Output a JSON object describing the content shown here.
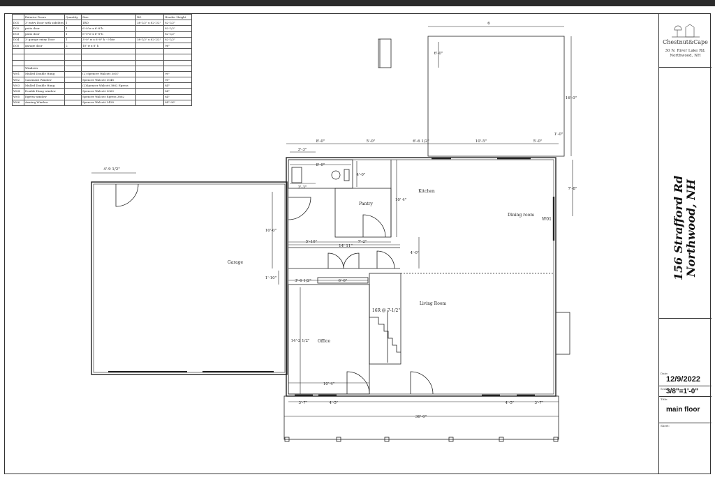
{
  "schedule": {
    "doors_header": [
      "",
      "Exterior Doors",
      "Quantity",
      "Size",
      "RO",
      "Header Height"
    ],
    "doors": [
      [
        "D01",
        "3' entry Door with sidelites",
        "1",
        "TBD",
        "38-1/2\" x 82-1/2\"",
        "82-1/2\""
      ],
      [
        "D02",
        "patio door",
        "1",
        "6'-0\"w x 6'-8\"h",
        "",
        "82-1/2\""
      ],
      [
        "D03",
        "patio door",
        "1",
        "6'-0\"w x 6'-8\"h",
        "",
        "82-1/2\""
      ],
      [
        "D04",
        "3' garage entry Door",
        "1",
        "3'-0\" w x 6'-8\" h - 9 lite",
        "38-1/2\" x 82-1/2\"",
        "82-1/2\""
      ],
      [
        "D05",
        "garage door",
        "2",
        "10' w x 8' h",
        "",
        "96\""
      ]
    ],
    "windows_header": [
      "",
      "Windows",
      "",
      "",
      "",
      ""
    ],
    "windows": [
      [
        "W01",
        "Mulled Double Hung",
        "",
        "(2) Spencer Walcott 3857",
        "",
        "90\""
      ],
      [
        "W02",
        "Casement Window",
        "",
        "Spencer Walcott 3048",
        "",
        "90\""
      ],
      [
        "W03",
        "Mulled Double Hung",
        "",
        "(2)Spencer Walcott 3862 Egress",
        "",
        "84\""
      ],
      [
        "W04",
        "Double Hung window",
        "",
        "Spencer Walcott 3060",
        "",
        "84\""
      ],
      [
        "W05",
        "Egress window",
        "",
        "Spencer Walcott Egress 3862",
        "",
        "84\""
      ],
      [
        "W06",
        "Awning Window",
        "",
        "Spencer Walcott 2428",
        "",
        "84\"-90\""
      ]
    ]
  },
  "title_block": {
    "company": "Chestnut&Cape",
    "company_addr1": "30 N. River Lake Rd.",
    "company_addr2": "Northwood, NH",
    "address_line1": "156 Strafford Rd",
    "address_line2": "Northwood, NH",
    "date_label": "Date:",
    "date": "12/9/2022",
    "scale_label": "Scale:",
    "scale": "3/8\"=1'-0\"",
    "title_label": "Title:",
    "title": "main floor",
    "sheet_label": "Sheet:"
  },
  "rooms": {
    "garage": "Garage",
    "pantry": "Pantry",
    "kitchen": "Kitchen",
    "dining": "Dining room",
    "living": "Living Room",
    "office": "Office",
    "stairs": "16R @ 7-1/2\"",
    "window_tag": "W01"
  },
  "dimensions": {
    "deck_top": "6",
    "deck_left": "6'-0\"",
    "deck_right": "16'-0\"",
    "corner": "1'-0\"",
    "top_a": "8'-0\"",
    "top_b": "5'-0\"",
    "top_c": "6'-6 1/2\"",
    "top_d": "10'-5\"",
    "top_e": "5'-0\"",
    "bath_w": "3'-3\"",
    "bath_inner": "8'-0\"",
    "bath_inner2": "3'-3\"",
    "bath_h": "4'-0\"",
    "garage_w": "4'-9 1/2\"",
    "kitchen_h": "10' 4\"",
    "right_h": "7'-8\"",
    "left_h": "10'-0\"",
    "hall_a": "5'-10\"",
    "hall_b": "7'-2\"",
    "hall_c": "14' 11\"",
    "stair_h": "4'-0\"",
    "left_small": "1'-10\"",
    "mud_a": "3'-6 1/2\"",
    "mud_b": "6'-6\"",
    "office_h": "14'-2 1/2\"",
    "office_w": "10'-4\"",
    "bot_a": "3'-7\"",
    "bot_b": "4'-5\"",
    "bot_c": "4'-5\"",
    "bot_d": "3'-7\"",
    "overall": "36'-0\""
  }
}
